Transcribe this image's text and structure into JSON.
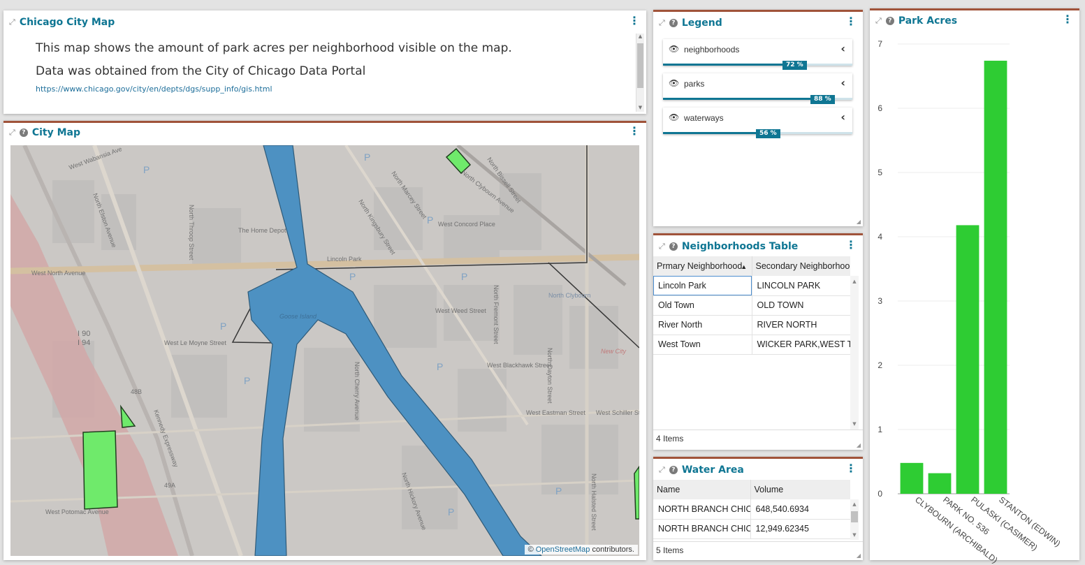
{
  "text_panel": {
    "title": "Chicago City Map",
    "line1": "This map shows the amount of park acres per neighborhood visible on the map.",
    "line2": "Data was obtained from the City of Chicago Data Portal",
    "link": "https://www.chicago.gov/city/en/depts/dgs/supp_info/gis.html"
  },
  "map_panel": {
    "title": "City Map",
    "attribution_prefix": "© ",
    "attribution_link": "OpenStreetMap",
    "attribution_suffix": " contributors.",
    "labels": {
      "lincoln_park": "Lincoln Park",
      "north_clybourn": "North Clybourn",
      "west_north_avenue": "West North Avenue",
      "home_depot": "The Home Depot",
      "i90": "I 90",
      "i94": "I 94",
      "kennedy": "Kennedy Expressway",
      "elston": "North Elston Avenue",
      "kingsbury": "North Kingsbury Street",
      "west_concord": "West Concord Place",
      "west_weed": "West Weed Street",
      "west_blackhawk": "West Blackhawk Street",
      "west_le_moyne": "West Le Moyne Street",
      "west_eastman": "West Eastman Street",
      "west_schiller": "West Schiller St",
      "west_potomac": "West Potomac Avenue",
      "west_wabansia": "West Wabansia Ave",
      "clybourn_ave": "North Clybourn Avenue",
      "bissell": "North Bissell Street",
      "halsted": "North Halsted Street",
      "cherry": "North Cherry Avenue",
      "fremont": "North Fremont Street",
      "dayton": "North Dayton Street",
      "new_city": "New City",
      "throop": "North Throop Street",
      "hickory": "North Hickory Avenue",
      "marcey": "North Marcey Street",
      "goose": "Goose Island",
      "exit_48b": "48B",
      "exit_49a": "49A"
    }
  },
  "legend_panel": {
    "title": "Legend",
    "items": [
      {
        "name": "neighborhoods",
        "opacity_label": "72 %",
        "opacity": 0.72
      },
      {
        "name": "parks",
        "opacity_label": "88 %",
        "opacity": 0.88
      },
      {
        "name": "waterways",
        "opacity_label": "56 %",
        "opacity": 0.56
      }
    ]
  },
  "neighborhoods_table": {
    "title": "Neighborhoods Table",
    "columns": [
      "Prmary Neighborhood",
      "Secondary Neighborhood"
    ],
    "rows": [
      [
        "Lincoln Park",
        "LINCOLN PARK"
      ],
      [
        "Old Town",
        "OLD TOWN"
      ],
      [
        "River North",
        "RIVER NORTH"
      ],
      [
        "West Town",
        "WICKER PARK,WEST TOWN"
      ]
    ],
    "footer": "4 Items"
  },
  "water_table": {
    "title": "Water Area",
    "columns": [
      "Name",
      "Volume"
    ],
    "rows": [
      [
        "NORTH BRANCH CHICAGO RIVER",
        "648,540.6934"
      ],
      [
        "NORTH BRANCH CHICAGO RIVER",
        "12,949.62345"
      ]
    ],
    "footer": "5 Items"
  },
  "chart_panel": {
    "title": "Park Acres"
  },
  "colors": {
    "accent": "#0f7693",
    "panel_border": "#a0533a",
    "park_green": "#6ef06a",
    "water_blue": "#4a92c6",
    "bar_green": "#2ecc33"
  },
  "chart_data": {
    "type": "bar",
    "title": "",
    "xlabel": "",
    "ylabel": "",
    "categories": [
      "CLYBOURN (ARCHIBALD)",
      "PARK NO. 536",
      "PULASKI (CASIMER)",
      "STANTON (EDWIN)"
    ],
    "values": [
      0.48,
      0.32,
      4.18,
      6.74
    ],
    "ylim": [
      0,
      7
    ],
    "yticks": [
      0,
      1,
      2,
      3,
      4,
      5,
      6,
      7
    ],
    "grid": true
  }
}
